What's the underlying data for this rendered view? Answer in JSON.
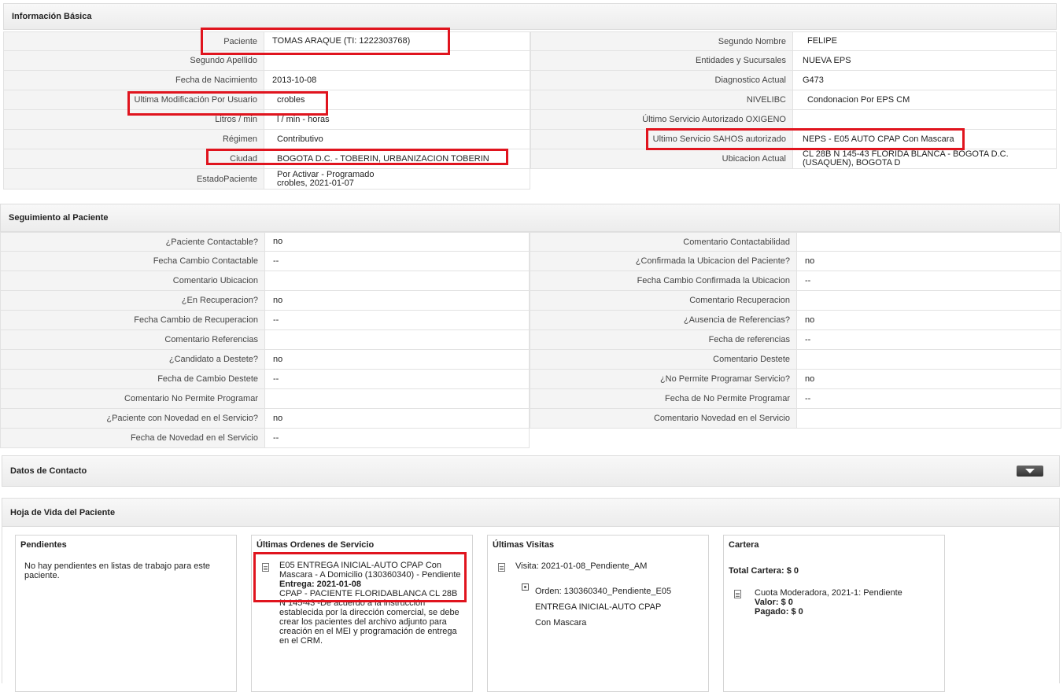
{
  "info": {
    "title": "Información Básica",
    "left_rows": [
      {
        "label": "Paciente",
        "value": "TOMAS ARAQUE (TI: 1222303768)"
      },
      {
        "label": "Segundo Apellido",
        "value": ""
      },
      {
        "label": "Fecha de Nacimiento",
        "value": "2013-10-08"
      },
      {
        "label": "Ultima Modificación Por Usuario",
        "value": "crobles"
      },
      {
        "label": "Litros / min",
        "value": "l / min - horas"
      },
      {
        "label": "Régimen",
        "value": "Contributivo"
      },
      {
        "label": "Ciudad",
        "value": "BOGOTA D.C. - TOBERIN, URBANIZACION TOBERIN"
      },
      {
        "label": "EstadoPaciente",
        "value": "Por Activar - Programado",
        "value2": "crobles, 2021-01-07"
      }
    ],
    "right_rows": [
      {
        "label": "Segundo Nombre",
        "value": "FELIPE"
      },
      {
        "label": "Entidades y Sucursales",
        "value": "NUEVA EPS"
      },
      {
        "label": "Diagnostico Actual",
        "value": "G473"
      },
      {
        "label": "NIVELIBC",
        "value": "Condonacion Por EPS CM"
      },
      {
        "label": "Último Servicio Autorizado OXIGENO",
        "value": ""
      },
      {
        "label": "Ultimo Servicio SAHOS autorizado",
        "value": "NEPS - E05 AUTO CPAP Con Mascara"
      },
      {
        "label": "Ubicacion Actual",
        "value": "CL 28B N 145-43 FLORIDA BLANCA - BOGOTA D.C. (USAQUEN), BOGOTA D"
      }
    ]
  },
  "seguimiento": {
    "title": "Seguimiento al Paciente",
    "left_rows": [
      {
        "label": "¿Paciente Contactable?",
        "value": "no"
      },
      {
        "label": "Fecha Cambio Contactable",
        "value": "--"
      },
      {
        "label": "Comentario Ubicacion",
        "value": ""
      },
      {
        "label": "¿En Recuperacion?",
        "value": "no"
      },
      {
        "label": "Fecha Cambio de Recuperacion",
        "value": "--"
      },
      {
        "label": "Comentario Referencias",
        "value": ""
      },
      {
        "label": "¿Candidato a Destete?",
        "value": "no"
      },
      {
        "label": "Fecha de Cambio Destete",
        "value": "--"
      },
      {
        "label": "Comentario No Permite Programar",
        "value": ""
      },
      {
        "label": "¿Paciente con Novedad en el Servicio?",
        "value": "no"
      },
      {
        "label": "Fecha de Novedad en el Servicio",
        "value": "--"
      }
    ],
    "right_rows": [
      {
        "label": "Comentario Contactabilidad",
        "value": ""
      },
      {
        "label": "¿Confirmada la Ubicacion del Paciente?",
        "value": "no"
      },
      {
        "label": "Fecha Cambio Confirmada la Ubicacion",
        "value": "--"
      },
      {
        "label": "Comentario Recuperacion",
        "value": ""
      },
      {
        "label": "¿Ausencia de Referencias?",
        "value": "no"
      },
      {
        "label": "Fecha de referencias",
        "value": "--"
      },
      {
        "label": "Comentario Destete",
        "value": ""
      },
      {
        "label": "¿No Permite Programar Servicio?",
        "value": "no"
      },
      {
        "label": "Fecha de No Permite Programar",
        "value": "--"
      },
      {
        "label": "Comentario Novedad en el Servicio",
        "value": ""
      }
    ]
  },
  "contacto": {
    "title": "Datos de Contacto"
  },
  "hoja": {
    "title": "Hoja de Vida del Paciente",
    "pendientes": {
      "title": "Pendientes",
      "text": "No hay pendientes en listas de trabajo para este paciente."
    },
    "ordenes": {
      "title": "Últimas Ordenes de Servicio",
      "line1": "E05 ENTREGA INICIAL-AUTO CPAP Con Mascara - A Domicilio (130360340) - Pendiente",
      "entrega": "Entrega: 2021-01-08",
      "desc": "CPAP - PACIENTE FLORIDABLANCA CL 28B N 145-43 -De acuerdo a la instrucción establecida por la dirección comercial, se debe crear los pacientes del archivo adjunto para creación en el MEI y programación de entrega en el CRM."
    },
    "visitas": {
      "title": "Últimas Visitas",
      "visita": "Visita: 2021-01-08_Pendiente_AM",
      "orden": "Orden: 130360340_Pendiente_E05 ENTREGA INICIAL-AUTO CPAP Con Mascara"
    },
    "cartera": {
      "title": "Cartera",
      "total": "Total Cartera: $ 0",
      "cuota": "Cuota Moderadora, 2021-1: Pendiente",
      "valor": "Valor: $ 0",
      "pagado": "Pagado: $ 0"
    }
  },
  "colors": {
    "highlight": "#e0141e",
    "header_bg": "#f0f0f0",
    "label_bg": "#f4f4f4"
  }
}
